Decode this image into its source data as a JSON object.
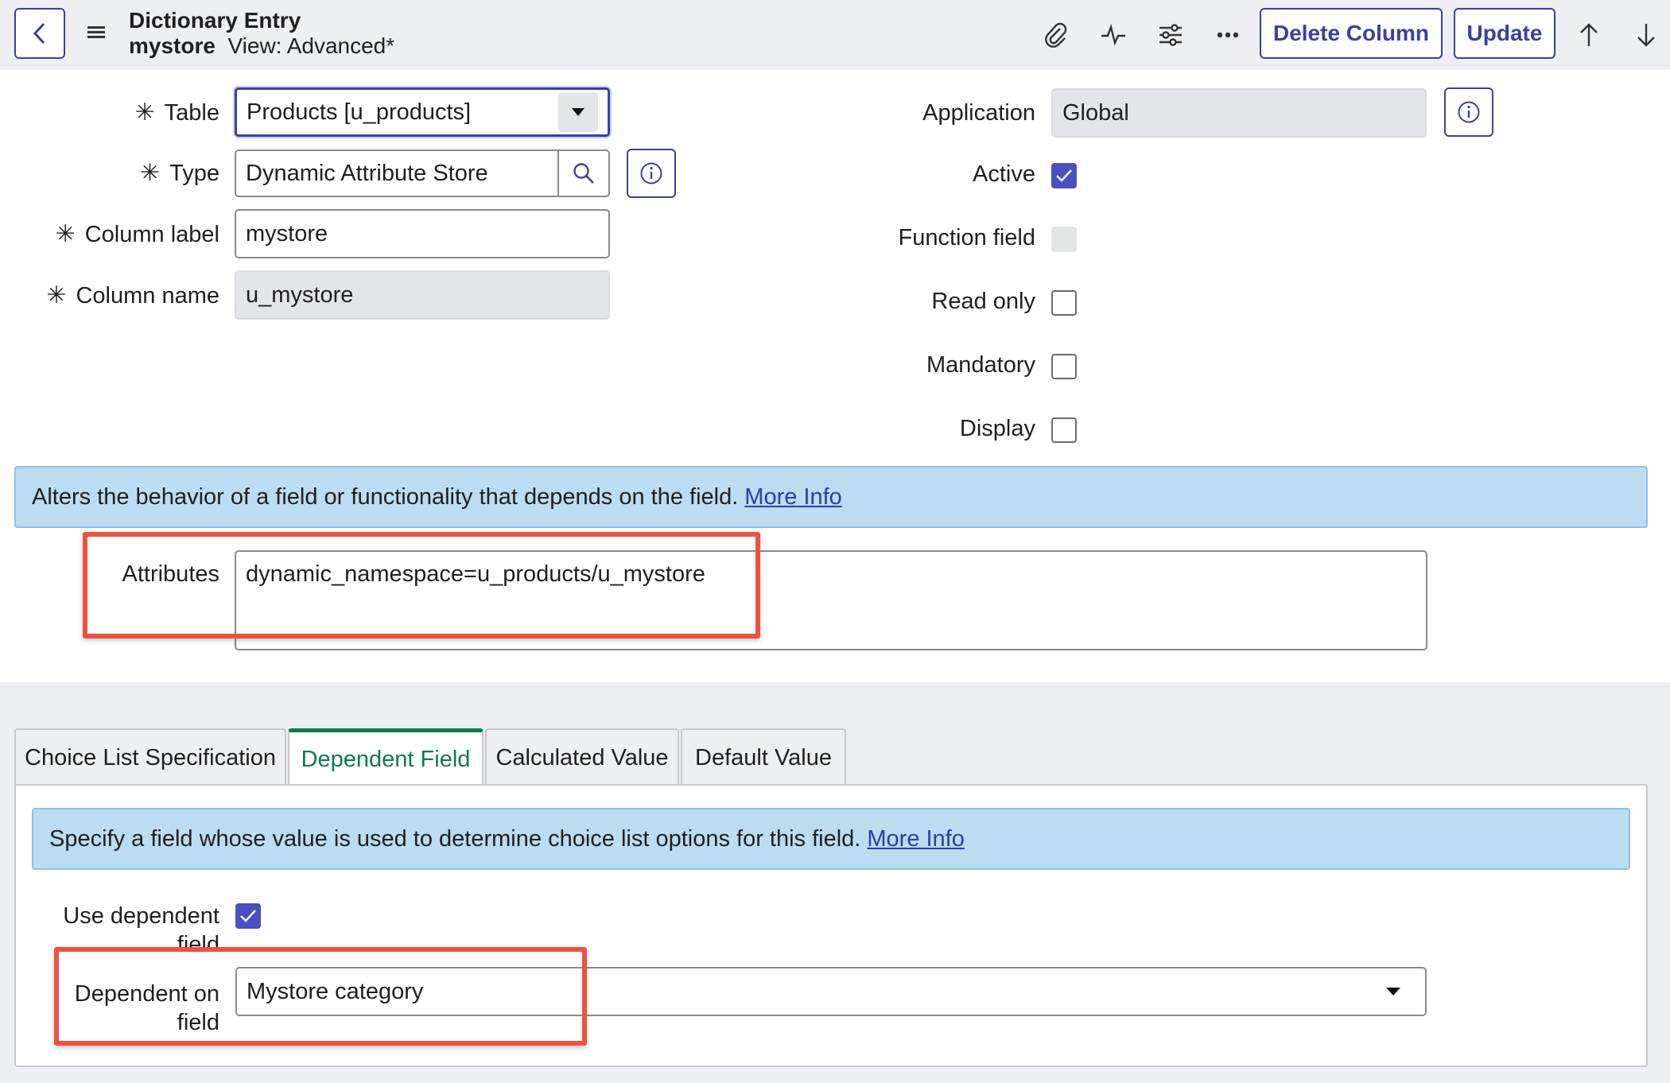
{
  "header": {
    "title": "Dictionary Entry",
    "record_name": "mystore",
    "view_label": "View: Advanced*",
    "icons": [
      "back-icon",
      "menu-icon",
      "paperclip-icon",
      "activity-icon",
      "settings-sliders-icon",
      "more-icon",
      "arrow-up-icon",
      "arrow-down-icon"
    ],
    "delete_label": "Delete Column",
    "update_label": "Update"
  },
  "form": {
    "table": {
      "label": "Table",
      "value": "Products [u_products]"
    },
    "type": {
      "label": "Type",
      "value": "Dynamic Attribute Store"
    },
    "column_label": {
      "label": "Column label",
      "value": "mystore"
    },
    "column_name": {
      "label": "Column name",
      "value": "u_mystore"
    },
    "application": {
      "label": "Application",
      "value": "Global"
    },
    "active": {
      "label": "Active",
      "checked": true
    },
    "function_field": {
      "label": "Function field",
      "checked": false
    },
    "read_only": {
      "label": "Read only",
      "checked": false
    },
    "mandatory": {
      "label": "Mandatory",
      "checked": false
    },
    "display": {
      "label": "Display",
      "checked": false
    },
    "attributes_banner": {
      "text": "Alters the behavior of a field or functionality that depends on the field.",
      "link": "More Info"
    },
    "attributes": {
      "label": "Attributes",
      "value": "dynamic_namespace=u_products/u_mystore"
    }
  },
  "tabs": [
    {
      "label": "Choice List Specification",
      "active": false
    },
    {
      "label": "Dependent Field",
      "active": true
    },
    {
      "label": "Calculated Value",
      "active": false
    },
    {
      "label": "Default Value",
      "active": false
    }
  ],
  "dependent": {
    "banner": {
      "text": "Specify a field whose value is used to determine choice list options for this field.",
      "link": "More Info"
    },
    "use_dependent": {
      "label_line1": "Use dependent",
      "label_line2": "field",
      "checked": true
    },
    "dependent_on": {
      "label_line1": "Dependent on",
      "label_line2": "field",
      "value": "Mystore category"
    }
  },
  "colors": {
    "accent": "#3a3fa6",
    "active_tab": "#0f7a52",
    "highlight": "#ef5140",
    "banner": "#bcdcf2"
  }
}
